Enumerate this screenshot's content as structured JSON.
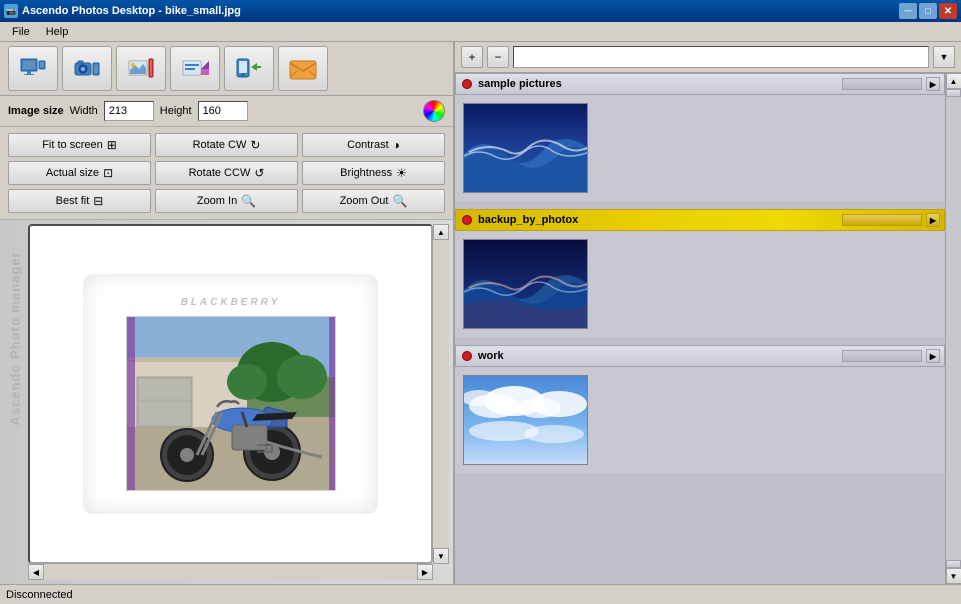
{
  "window": {
    "title": "Ascendo Photos Desktop - bike_small.jpg",
    "minimize": "─",
    "maximize": "□",
    "close": "✕"
  },
  "menu": {
    "items": [
      "File",
      "Help"
    ]
  },
  "toolbar": {
    "buttons": [
      {
        "id": "computer",
        "icon": "🖥",
        "label": ""
      },
      {
        "id": "camera",
        "icon": "📷",
        "label": ""
      },
      {
        "id": "photos",
        "icon": "🖼",
        "label": ""
      },
      {
        "id": "edit",
        "icon": "✏",
        "label": ""
      },
      {
        "id": "transfer",
        "icon": "📲",
        "label": ""
      },
      {
        "id": "mail",
        "icon": "📬",
        "label": ""
      }
    ]
  },
  "imageSize": {
    "label": "Image size",
    "widthLabel": "Width",
    "widthValue": "213",
    "heightLabel": "Height",
    "heightValue": "160"
  },
  "controls": {
    "fitToScreen": "Fit to screen",
    "actualSize": "Actual size",
    "bestFit": "Best fit",
    "rotateCW": "Rotate CW",
    "rotateCCW": "Rotate CCW",
    "zoomIn": "Zoom In",
    "contrast": "Contrast",
    "brightness": "Brightness",
    "zoomOut": "Zoom Out"
  },
  "imageArea": {
    "brandText": "BLACKBERRY"
  },
  "rightPanel": {
    "addButton": "+",
    "removeButton": "−",
    "dropdownArrow": "▼",
    "albums": [
      {
        "id": "sample_pictures",
        "label": "sample pictures",
        "selected": false,
        "thumbnails": [
          "wave1"
        ]
      },
      {
        "id": "backup_by_photox",
        "label": "backup_by_photox",
        "selected": true,
        "thumbnails": [
          "wave2"
        ]
      },
      {
        "id": "work",
        "label": "work",
        "selected": false,
        "thumbnails": [
          "sky1"
        ]
      }
    ]
  },
  "statusBar": {
    "text": "Disconnected"
  },
  "watermark": "Ascendo Photo manager"
}
